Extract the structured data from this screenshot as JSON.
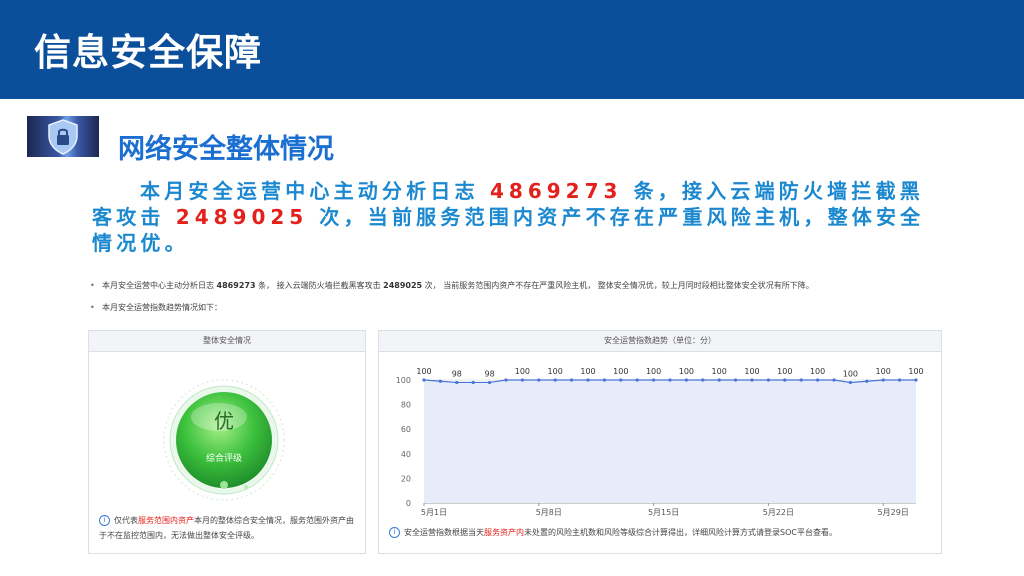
{
  "header": {
    "title": "信息安全保障"
  },
  "section": {
    "title": "网络安全整体情况",
    "icon": "shield-lock-icon"
  },
  "summary": {
    "part1": "本月安全运营中心主动分析日志",
    "logs": "4869273",
    "part2": "条，接入云端防火墙拦截黑客攻击",
    "attacks": "2489025",
    "part3": "次，当前服务范围内资产不存在严重风险主机，整体安全情况优。"
  },
  "bullets": {
    "b1_part1": "本月安全运营中心主动分析日志",
    "b1_logs": "4869273",
    "b1_part2": "条， 接入云端防火墙拦截黑客攻击",
    "b1_attacks": "2489025",
    "b1_part3": "次， 当前服务范围内资产不存在严重风险主机， 整体安全情况优，较上月同时段相比整体安全状况有所下降。",
    "b2": "本月安全运营指数趋势情况如下："
  },
  "left_panel": {
    "title": "整体安全情况",
    "grade": "优",
    "grade_label": "综合评级",
    "note_part1": "仅代表",
    "note_highlight": "服务范围内资产",
    "note_part2": "本月的整体综合安全情况，服务范围外资产由于不在监控范围内，无法做出整体安全评级。"
  },
  "right_panel": {
    "title": "安全运营指数趋势（单位：分）",
    "note_part1": "安全运营指数根据当天",
    "note_highlight": "服务资产内",
    "note_part2": "未处置的风险主机数和风险等级综合计算得出，详细风险计算方式请登录SOC平台查看。"
  },
  "colors": {
    "header_bg": "#0b4f9a",
    "accent_blue": "#1b88cf",
    "highlight_red": "#e3201b",
    "grade_green": "#3ec23e",
    "chart_line": "#4a74d6",
    "chart_fill": "#e6ecfa"
  },
  "chart_data": {
    "type": "area",
    "title": "安全运营指数趋势（单位：分）",
    "xlabel": "",
    "ylabel": "",
    "ylim": [
      0,
      100
    ],
    "yticks": [
      0,
      20,
      40,
      60,
      80,
      100
    ],
    "x_tick_labels": [
      "5月1日",
      "5月8日",
      "5月15日",
      "5月22日",
      "5月29日"
    ],
    "x_tick_indices": [
      0,
      7,
      14,
      21,
      28
    ],
    "grid": true,
    "x": [
      "5月1日",
      "5月2日",
      "5月3日",
      "5月4日",
      "5月5日",
      "5月6日",
      "5月7日",
      "5月8日",
      "5月9日",
      "5月10日",
      "5月11日",
      "5月12日",
      "5月13日",
      "5月14日",
      "5月15日",
      "5月16日",
      "5月17日",
      "5月18日",
      "5月19日",
      "5月20日",
      "5月21日",
      "5月22日",
      "5月23日",
      "5月24日",
      "5月25日",
      "5月26日",
      "5月27日",
      "5月28日",
      "5月29日",
      "5月30日",
      "5月31日"
    ],
    "values": [
      100,
      99,
      98,
      98,
      98,
      100,
      100,
      100,
      100,
      100,
      100,
      100,
      100,
      100,
      100,
      100,
      100,
      100,
      100,
      100,
      100,
      100,
      100,
      100,
      100,
      100,
      98,
      99,
      100,
      100,
      100
    ],
    "data_labels": [
      {
        "index": 0,
        "text": "100"
      },
      {
        "index": 2,
        "text": "98"
      },
      {
        "index": 4,
        "text": "98"
      },
      {
        "index": 6,
        "text": "100"
      },
      {
        "index": 8,
        "text": "100"
      },
      {
        "index": 10,
        "text": "100"
      },
      {
        "index": 12,
        "text": "100"
      },
      {
        "index": 14,
        "text": "100"
      },
      {
        "index": 16,
        "text": "100"
      },
      {
        "index": 18,
        "text": "100"
      },
      {
        "index": 20,
        "text": "100"
      },
      {
        "index": 22,
        "text": "100"
      },
      {
        "index": 24,
        "text": "100"
      },
      {
        "index": 26,
        "text": "100"
      },
      {
        "index": 28,
        "text": "100"
      },
      {
        "index": 30,
        "text": "100"
      }
    ]
  }
}
